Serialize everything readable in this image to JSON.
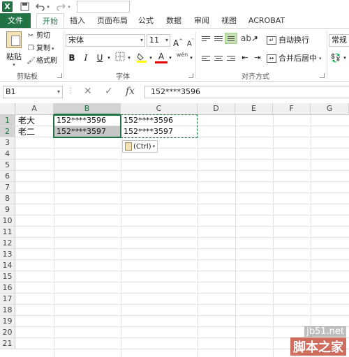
{
  "quick_access": {
    "icons": [
      "excel-logo",
      "save-icon",
      "undo-icon",
      "redo-icon"
    ]
  },
  "tabs": [
    "文件",
    "开始",
    "插入",
    "页面布局",
    "公式",
    "数据",
    "审阅",
    "视图",
    "ACROBAT"
  ],
  "ribbon": {
    "clipboard": {
      "paste": "粘贴",
      "cut": "剪切",
      "copy": "复制",
      "format_painter": "格式刷",
      "label": "剪贴板"
    },
    "font": {
      "name": "宋体",
      "size": "11",
      "grow": "A",
      "shrink": "A",
      "bold": "B",
      "italic": "I",
      "underline": "U",
      "font_color": "A",
      "phonetic": "wén",
      "label": "字体"
    },
    "alignment": {
      "wrap_text": "自动换行",
      "merge_center": "合并后居中",
      "label": "对齐方式"
    },
    "number": {
      "format": "常规"
    }
  },
  "formula_bar": {
    "name_box": "B1",
    "cancel": "✕",
    "enter": "✓",
    "fx": "fx",
    "formula": "152****3596"
  },
  "grid": {
    "columns": [
      "A",
      "B",
      "C",
      "D",
      "E",
      "F",
      "G"
    ],
    "rows": [
      "1",
      "2",
      "3",
      "4",
      "5",
      "6",
      "7",
      "8",
      "9",
      "10",
      "11",
      "12",
      "13",
      "14",
      "15",
      "16",
      "17",
      "18",
      "19",
      "20",
      "21"
    ],
    "cells": {
      "A1": "老大",
      "A2": "老二",
      "B1": "152****3596",
      "B2": "152****3597",
      "C1": "152****3596",
      "C2": "152****3597"
    },
    "paste_options": "(Ctrl)"
  },
  "watermark": {
    "site": "jb51.net",
    "name": "脚本之家"
  },
  "colors": {
    "accent": "#217346",
    "selection_gray": "#c6c6c6"
  }
}
